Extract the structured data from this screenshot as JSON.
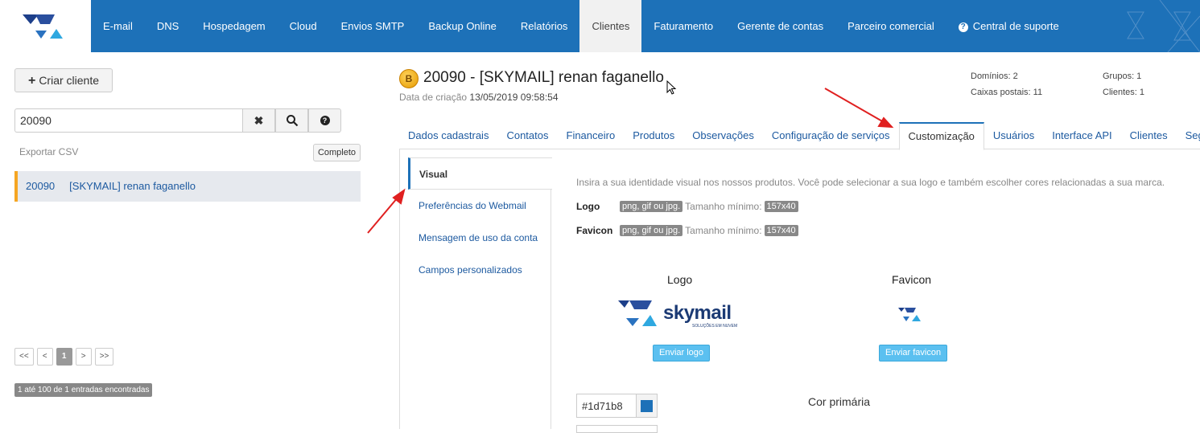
{
  "nav": {
    "items": [
      "E-mail",
      "DNS",
      "Hospedagem",
      "Cloud",
      "Envios SMTP",
      "Backup Online",
      "Relatórios",
      "Clientes",
      "Faturamento",
      "Gerente de contas",
      "Parceiro comercial"
    ],
    "support_label": "Central de suporte"
  },
  "left": {
    "create_label": "Criar cliente",
    "search_value": "20090",
    "export_label": "Exportar CSV",
    "complete_label": "Completo",
    "result": {
      "id": "20090",
      "name": "[SKYMAIL] renan faganello"
    },
    "pager": [
      "<<",
      "<",
      "1",
      ">",
      ">>"
    ],
    "count_text": "1 até 100 de 1 entradas encontradas"
  },
  "client": {
    "badge": "B",
    "title": "20090 - [SKYMAIL] renan faganello",
    "created_label": "Data de criação",
    "created_value": "13/05/2019 09:58:54",
    "stats": {
      "domains": "Domínios: 2",
      "mailboxes": "Caixas postais: 11",
      "groups": "Grupos: 1",
      "clients": "Clientes: 1"
    }
  },
  "tabs": [
    "Dados cadastrais",
    "Contatos",
    "Financeiro",
    "Produtos",
    "Observações",
    "Configuração de serviços",
    "Customização",
    "Usuários",
    "Interface API",
    "Clientes",
    "Segura"
  ],
  "subnav": [
    "Visual",
    "Preferências do Webmail",
    "Mensagem de uso da conta",
    "Campos personalizados"
  ],
  "visual": {
    "intro": "Insira a sua identidade visual nos nossos produtos. Você pode selecionar a sua logo e também escolher cores relacionadas a sua marca.",
    "logo_label": "Logo",
    "favicon_label": "Favicon",
    "formats": "png, gif ou jpg.",
    "min_size_label": "Tamanho mínimo:",
    "min_size": "157x40",
    "logo_title": "Logo",
    "favicon_title": "Favicon",
    "brand_name": "skymail",
    "brand_tagline": "SOLUÇÕES EM NUVEM",
    "send_logo": "Enviar logo",
    "send_favicon": "Enviar favicon",
    "primary_color_value": "#1d71b8",
    "primary_color_label": "Cor primária"
  },
  "colors": {
    "primary": "#1d71b8",
    "accent": "#f5a623",
    "annotation": "#e02020"
  }
}
